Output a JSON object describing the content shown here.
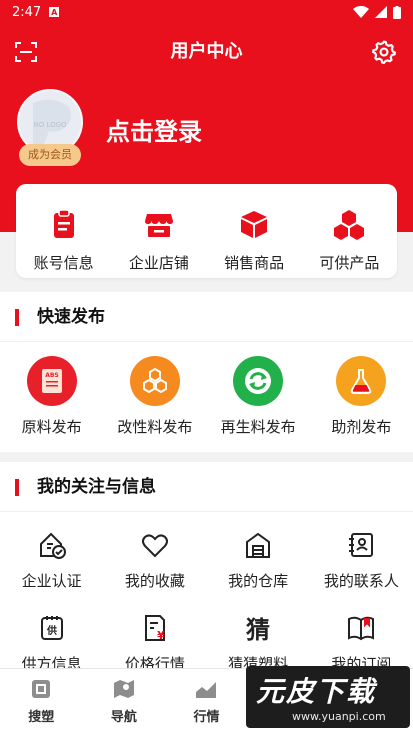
{
  "status_bar": {
    "time": "2:47",
    "notification": "A"
  },
  "header": {
    "title": "用户中心"
  },
  "profile": {
    "login_text": "点击登录",
    "member_badge": "成为会员",
    "avatar_watermark": "NO LOGO"
  },
  "account": {
    "items": [
      {
        "label": "账号信息",
        "icon": "clipboard-icon"
      },
      {
        "label": "企业店铺",
        "icon": "store-icon"
      },
      {
        "label": "销售商品",
        "icon": "box-icon"
      },
      {
        "label": "可供产品",
        "icon": "cubes-icon"
      }
    ]
  },
  "quick_publish": {
    "title": "快速发布",
    "items": [
      {
        "label": "原料发布",
        "icon": "abs-document-icon",
        "color": "#e8202a",
        "icon_text": "ABS"
      },
      {
        "label": "改性料发布",
        "icon": "hexagon-cluster-icon",
        "color": "#f58a1f"
      },
      {
        "label": "再生料发布",
        "icon": "recycle-icon",
        "color": "#22b04b"
      },
      {
        "label": "助剂发布",
        "icon": "flask-icon",
        "color": "#f5a31f"
      }
    ]
  },
  "follow": {
    "title": "我的关注与信息",
    "row1": [
      {
        "label": "企业认证",
        "icon": "enterprise-verify-icon"
      },
      {
        "label": "我的收藏",
        "icon": "heart-icon"
      },
      {
        "label": "我的仓库",
        "icon": "warehouse-icon"
      },
      {
        "label": "我的联系人",
        "icon": "contact-card-icon"
      }
    ],
    "row2": [
      {
        "label": "供方信息",
        "icon": "supply-icon",
        "icon_text": "供"
      },
      {
        "label": "价格行情",
        "icon": "price-doc-icon",
        "icon_text": "¥"
      },
      {
        "label": "猜猜塑料",
        "icon": "guess-icon",
        "icon_text": "猜"
      },
      {
        "label": "我的订阅",
        "icon": "book-icon"
      }
    ]
  },
  "tabbar": {
    "items": [
      {
        "label": "搜塑",
        "icon": "search-plastic-icon"
      },
      {
        "label": "导航",
        "icon": "map-icon"
      },
      {
        "label": "行情",
        "icon": "chart-icon"
      }
    ]
  },
  "watermark": {
    "brand": "元皮下载",
    "url": "www.yuanpi.com"
  },
  "colors": {
    "primary": "#e8101d",
    "background": "#f2f2f2"
  }
}
